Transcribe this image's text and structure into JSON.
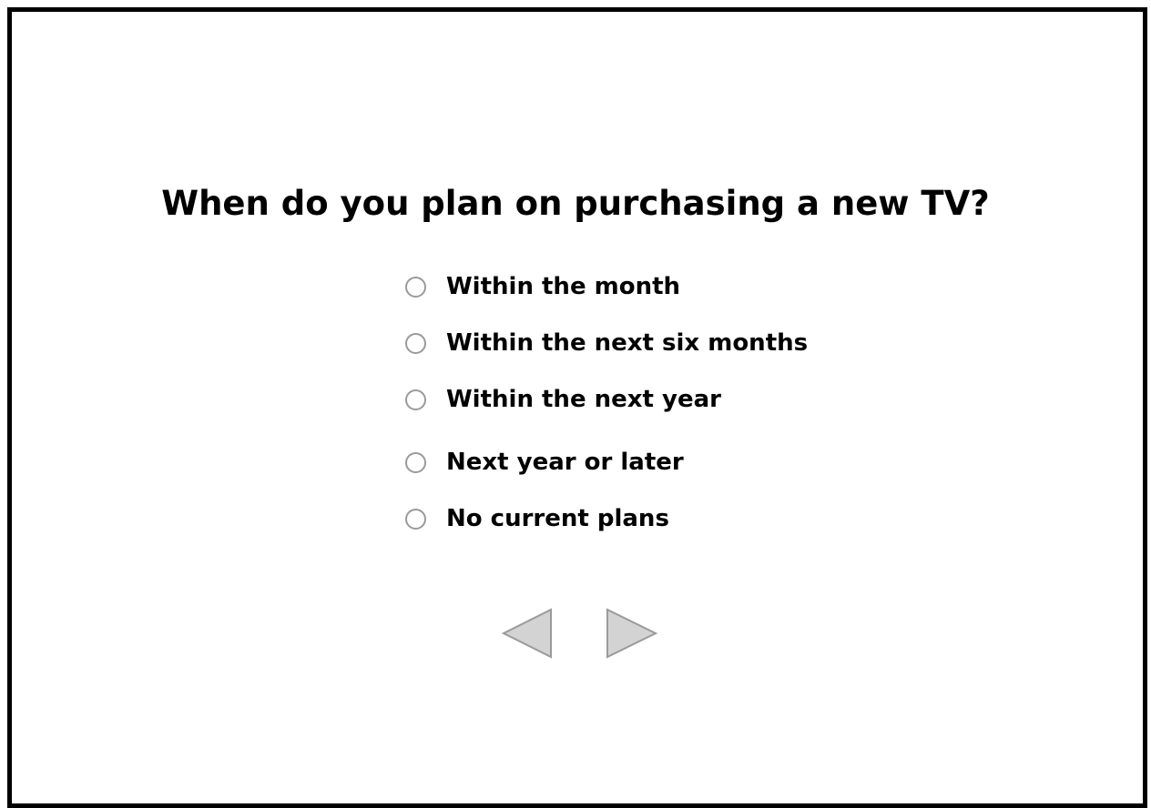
{
  "survey": {
    "question": "When do you plan on purchasing a new TV?",
    "options": [
      {
        "label": "Within the month",
        "selected": false
      },
      {
        "label": "Within the next six months",
        "selected": false
      },
      {
        "label": "Within the next year",
        "selected": false
      },
      {
        "label": "Next year or later",
        "selected": false
      },
      {
        "label": "No current plans",
        "selected": false
      }
    ]
  },
  "navigation": {
    "back_icon": "left-triangle-icon",
    "next_icon": "right-triangle-icon"
  },
  "colors": {
    "frame_border": "#000000",
    "radio_border": "#9a9a9a",
    "nav_fill": "#d3d3d3",
    "nav_stroke": "#9a9a9a"
  }
}
